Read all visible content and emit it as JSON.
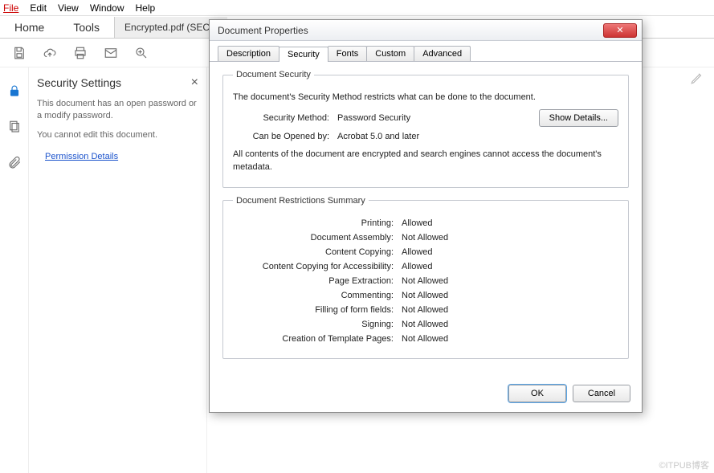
{
  "menu": {
    "file": "File",
    "edit": "Edit",
    "view": "View",
    "window": "Window",
    "help": "Help"
  },
  "maintabs": {
    "home": "Home",
    "tools": "Tools",
    "doc": "Encrypted.pdf (SEC..."
  },
  "side": {
    "title": "Security Settings",
    "p1": "This document has an open password or a modify password.",
    "p2": "You cannot edit this document.",
    "link": "Permission Details"
  },
  "dialog": {
    "title": "Document Properties",
    "tabs": {
      "description": "Description",
      "security": "Security",
      "fonts": "Fonts",
      "custom": "Custom",
      "advanced": "Advanced"
    },
    "docsec": {
      "legend": "Document Security",
      "intro": "The document's Security Method restricts what can be done to the document.",
      "method_label": "Security Method:",
      "method_value": "Password Security",
      "show_details": "Show Details...",
      "open_label": "Can be Opened by:",
      "open_value": "Acrobat 5.0 and later",
      "note": "All contents of the document are encrypted and search engines cannot access the document's metadata."
    },
    "restr": {
      "legend": "Document Restrictions Summary",
      "rows": [
        {
          "label": "Printing:",
          "value": "Allowed"
        },
        {
          "label": "Document Assembly:",
          "value": "Not Allowed"
        },
        {
          "label": "Content Copying:",
          "value": "Allowed"
        },
        {
          "label": "Content Copying for Accessibility:",
          "value": "Allowed"
        },
        {
          "label": "Page Extraction:",
          "value": "Not Allowed"
        },
        {
          "label": "Commenting:",
          "value": "Not Allowed"
        },
        {
          "label": "Filling of form fields:",
          "value": "Not Allowed"
        },
        {
          "label": "Signing:",
          "value": "Not Allowed"
        },
        {
          "label": "Creation of Template Pages:",
          "value": "Not Allowed"
        }
      ]
    },
    "ok": "OK",
    "cancel": "Cancel"
  },
  "watermark": "©ITPUB博客"
}
